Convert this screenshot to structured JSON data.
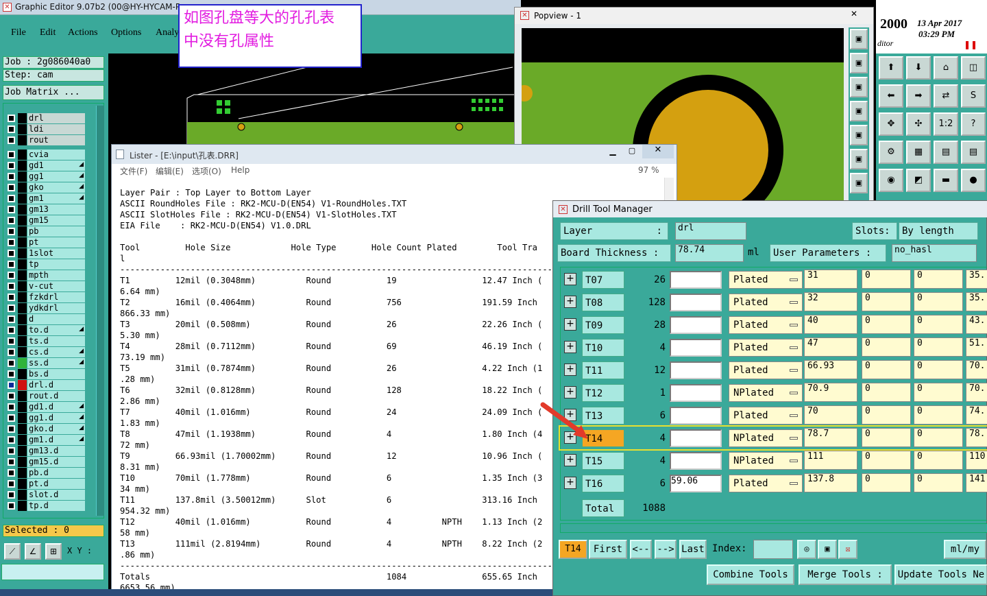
{
  "main_window": {
    "title": "Graphic Editor 9.07b2 (00@HY-HYCAM-P",
    "menu": [
      "File",
      "Edit",
      "Actions",
      "Options",
      "Analy"
    ],
    "job": "Job : 2g086040a0",
    "step": "Step: cam",
    "job_matrix": "Job Matrix ...",
    "selected": "Selected : 0",
    "xy_label": "X Y :"
  },
  "layers": [
    "drl",
    "ldi",
    "rout",
    "cvia",
    "gd1",
    "gg1",
    "gko",
    "gm1",
    "gm13",
    "gm15",
    "pb",
    "pt",
    "1slot",
    "tp",
    "mpth",
    "v-cut",
    "fzkdrl",
    "ydkdrl",
    "d",
    "to.d",
    "ts.d",
    "cs.d",
    "ss.d",
    "bs.d",
    "drl.d",
    "rout.d",
    "gd1.d",
    "gg1.d",
    "gko.d",
    "gm1.d",
    "gm13.d",
    "gm15.d",
    "pb.d",
    "pt.d",
    "slot.d",
    "tp.d"
  ],
  "annotation": {
    "line1": "如图孔盘等大的孔孔表",
    "line2": "中没有孔属性"
  },
  "popview": {
    "title": "Popview - 1"
  },
  "clock": {
    "year": "2000",
    "date": "13 Apr 2017",
    "time": "03:29 PM",
    "app": "ditor"
  },
  "icon_labels": {
    "one_two": "1:2",
    "help": "?"
  },
  "lister": {
    "title": "Lister - [E:\\input\\孔表.DRR]",
    "menu": [
      "文件(F)",
      "编辑(E)",
      "选项(O)",
      "Help"
    ],
    "zoom": "97 %",
    "body": "Layer Pair : Top Layer to Bottom Layer\nASCII RoundHoles File : RK2-MCU-D(EN54) V1-RoundHoles.TXT\nASCII SlotHoles File : RK2-MCU-D(EN54) V1-SlotHoles.TXT\nEIA File    : RK2-MCU-D(EN54) V1.0.DRL\n\nTool         Hole Size            Hole Type       Hole Count Plated        Tool Tra\nl\n--------------------------------------------------------------------------------------\nT1         12mil (0.3048mm)          Round           19                 12.47 Inch (\n6.64 mm)\nT2         16mil (0.4064mm)          Round           756                191.59 Inch\n866.33 mm)\nT3         20mil (0.508mm)           Round           26                 22.26 Inch (\n5.30 mm)\nT4         28mil (0.7112mm)          Round           69                 46.19 Inch (\n73.19 mm)\nT5         31mil (0.7874mm)          Round           26                 4.22 Inch (1\n.28 mm)\nT6         32mil (0.8128mm)          Round           128                18.22 Inch (\n2.86 mm)\nT7         40mil (1.016mm)           Round           24                 24.09 Inch (\n1.83 mm)\nT8         47mil (1.1938mm)          Round           4                  1.80 Inch (4\n72 mm)\nT9         66.93mil (1.70002mm)      Round           12                 10.96 Inch (\n8.31 mm)\nT10        70mil (1.778mm)           Round           6                  1.35 Inch (3\n34 mm)\nT11        137.8mil (3.50012mm)      Slot            6                  313.16 Inch\n954.32 mm)\nT12        40mil (1.016mm)           Round           4          NPTH    1.13 Inch (2\n58 mm)\nT13        111mil (2.8194mm)         Round           4          NPTH    8.22 Inch (2\n.86 mm)\n--------------------------------------------------------------------------------------\nTotals                                               1084               655.65 Inch\n6653.56 mm)"
  },
  "dtm": {
    "title": "Drill Tool Manager",
    "layer_label": "Layer",
    "layer_colon": ":",
    "layer_value": "drl",
    "slots_label": "Slots:",
    "slots_value": "By length",
    "thickness_label": "Board Thickness :",
    "thickness_value": "78.74",
    "thickness_unit": "ml",
    "user_params_label": "User Parameters  :",
    "user_params_value": "no_hasl",
    "rows": [
      {
        "tool": "T07",
        "count": "26",
        "w": "",
        "type": "Plated",
        "c1": "31",
        "c2": "0",
        "c3": "0",
        "c4": "35."
      },
      {
        "tool": "T08",
        "count": "128",
        "w": "",
        "type": "Plated",
        "c1": "32",
        "c2": "0",
        "c3": "0",
        "c4": "35."
      },
      {
        "tool": "T09",
        "count": "28",
        "w": "",
        "type": "Plated",
        "c1": "40",
        "c2": "0",
        "c3": "0",
        "c4": "43."
      },
      {
        "tool": "T10",
        "count": "4",
        "w": "",
        "type": "Plated",
        "c1": "47",
        "c2": "0",
        "c3": "0",
        "c4": "51."
      },
      {
        "tool": "T11",
        "count": "12",
        "w": "",
        "type": "Plated",
        "c1": "66.93",
        "c2": "0",
        "c3": "0",
        "c4": "70."
      },
      {
        "tool": "T12",
        "count": "1",
        "w": "",
        "type": "NPlated",
        "c1": "70.9",
        "c2": "0",
        "c3": "0",
        "c4": "70."
      },
      {
        "tool": "T13",
        "count": "6",
        "w": "",
        "type": "Plated",
        "c1": "70",
        "c2": "0",
        "c3": "0",
        "c4": "74."
      },
      {
        "tool": "T14",
        "count": "4",
        "w": "",
        "type": "NPlated",
        "c1": "78.7",
        "c2": "0",
        "c3": "0",
        "c4": "78."
      },
      {
        "tool": "T15",
        "count": "4",
        "w": "",
        "type": "NPlated",
        "c1": "111",
        "c2": "0",
        "c3": "0",
        "c4": "110"
      },
      {
        "tool": "T16",
        "count": "6",
        "w": "59.06",
        "type": "Plated",
        "c1": "137.8",
        "c2": "0",
        "c3": "0",
        "c4": "141"
      }
    ],
    "total_label": "Total",
    "total_value": "1088",
    "current_tool": "T14",
    "nav": {
      "first": "First",
      "prev": "<--",
      "next": "-->",
      "last": "Last",
      "index": "Index:",
      "unit": "ml/my"
    },
    "combine": "Combine Tools",
    "merge": "Merge Tools :",
    "update": "Update Tools Ne"
  },
  "colors": {
    "teal": "#3aa99a",
    "field": "#fffbd0",
    "highlight": "#f5a623",
    "pcb_green": "#6aaa28",
    "pad": "#d4a010"
  }
}
